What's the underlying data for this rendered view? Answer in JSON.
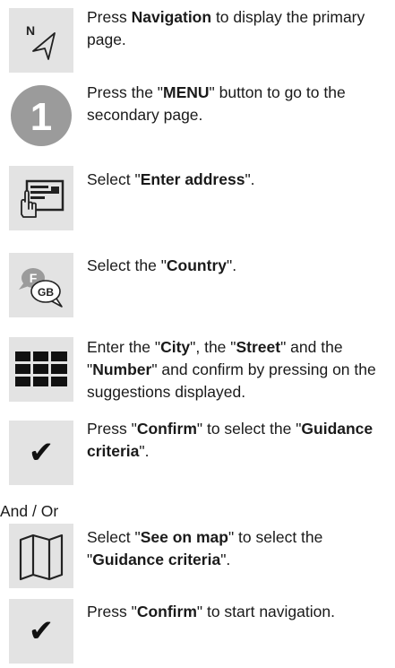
{
  "steps": [
    {
      "icon": "navigation-icon",
      "parts": [
        {
          "t": "Press "
        },
        {
          "t": "Navigation",
          "b": true
        },
        {
          "t": " to display the primary page."
        }
      ]
    },
    {
      "icon": "step-one-icon",
      "badge": "1",
      "parts": [
        {
          "t": "Press the \""
        },
        {
          "t": "MENU",
          "b": true
        },
        {
          "t": "\" button to go to the secondary page."
        }
      ]
    },
    {
      "icon": "enter-address-icon",
      "parts": [
        {
          "t": "Select \""
        },
        {
          "t": "Enter address",
          "b": true
        },
        {
          "t": "\"."
        }
      ]
    },
    {
      "icon": "country-icon",
      "flag_top": "F",
      "flag_bottom": "GB",
      "parts": [
        {
          "t": "Select the \""
        },
        {
          "t": "Country",
          "b": true
        },
        {
          "t": "\"."
        }
      ]
    },
    {
      "icon": "keyboard-grid-icon",
      "parts": [
        {
          "t": "Enter the \""
        },
        {
          "t": "City",
          "b": true
        },
        {
          "t": "\", the \""
        },
        {
          "t": "Street",
          "b": true
        },
        {
          "t": "\" and the \""
        },
        {
          "t": "Number",
          "b": true
        },
        {
          "t": "\" and confirm by pressing on the suggestions displayed."
        }
      ]
    },
    {
      "icon": "checkmark-icon",
      "parts": [
        {
          "t": "Press \""
        },
        {
          "t": "Confirm",
          "b": true
        },
        {
          "t": "\" to select the \""
        },
        {
          "t": "Guidance criteria",
          "b": true
        },
        {
          "t": "\"."
        }
      ]
    },
    {
      "icon": "map-icon",
      "parts": [
        {
          "t": "Select \""
        },
        {
          "t": "See on map",
          "b": true
        },
        {
          "t": "\" to select the \""
        },
        {
          "t": "Guidance criteria",
          "b": true
        },
        {
          "t": "\"."
        }
      ]
    },
    {
      "icon": "checkmark-icon",
      "parts": [
        {
          "t": "Press \""
        },
        {
          "t": "Confirm",
          "b": true
        },
        {
          "t": "\" to start navigation."
        }
      ]
    }
  ],
  "and_or": "And / Or",
  "nav_letter": "N",
  "check_glyph": "✔"
}
